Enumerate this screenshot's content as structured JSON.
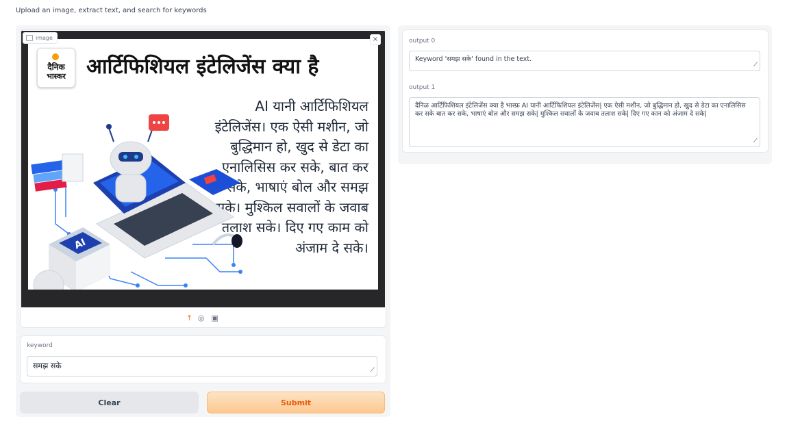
{
  "description": "Upload an image, extract text, and search for keywords",
  "image_input": {
    "label": "image",
    "close_symbol": "×",
    "picture": {
      "logo_line1": "दैनिक",
      "logo_line2": "भास्कर",
      "title": "आर्टिफिशियल इंटेलिजेंस क्या है",
      "body": "AI यानी आर्टिफिशियल इंटेलिजेंस। एक ऐसी मशीन, जो बुद्धिमान हो, खुद से डेटा का एनालिसिस कर सके, बात कर सके, भाषाएं बोल और समझ सके। मुश्किल सवालों के जवाब तलाश सके। दिए गए काम को अंजाम दे सके।",
      "chip_label": "AI"
    },
    "upload_icon": "⤒",
    "webcam_icon": "◎",
    "clipboard_icon": "▣"
  },
  "keyword": {
    "label": "keyword",
    "value": "समझ सके",
    "resize_glyph": "⟋"
  },
  "buttons": {
    "clear": "Clear",
    "submit": "Submit"
  },
  "outputs": [
    {
      "label": "output 0",
      "value": "Keyword 'समझ सके' found in the text."
    },
    {
      "label": "output 1",
      "value": "दैनिळ आर्टिफिशियल इंटेलिजेंस क्या है भास्फ्र AI यानी आर्टिफिशियल इंटेलिजेंस| एक ऐसी मशीन, जो बुद्धिमान हो, खुद से डेटा का एनालिसिस कर सके बात कर सके, भाषाएं बोल और समझ सके| मुश्किल सवालों के जवाब तलाश सके| दिए गए कान को अंजाम दे सके|"
    }
  ],
  "colors": {
    "accent": "#ea580c",
    "submit_bg": "#fdc890",
    "panel_bg": "#f4f5f7",
    "dark_bg": "#27272a"
  }
}
